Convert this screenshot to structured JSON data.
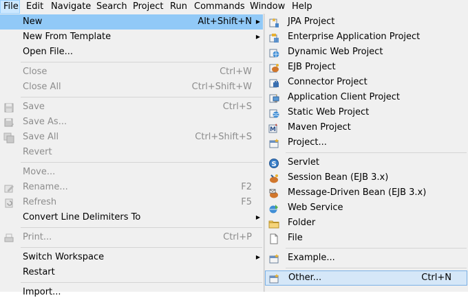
{
  "menubar": {
    "items": [
      "File",
      "Edit",
      "Navigate",
      "Search",
      "Project",
      "Run",
      "Commands",
      "Window",
      "Help"
    ]
  },
  "file_menu": {
    "items": [
      {
        "label": "New",
        "accel": "Alt+Shift+N",
        "submenu": true
      },
      {
        "label": "New From Template",
        "accel": "",
        "submenu": true
      },
      {
        "label": "Open File...",
        "accel": ""
      },
      {
        "label": "Close",
        "accel": "Ctrl+W"
      },
      {
        "label": "Close All",
        "accel": "Ctrl+Shift+W"
      },
      {
        "label": "Save",
        "accel": "Ctrl+S"
      },
      {
        "label": "Save As...",
        "accel": ""
      },
      {
        "label": "Save All",
        "accel": "Ctrl+Shift+S"
      },
      {
        "label": "Revert",
        "accel": ""
      },
      {
        "label": "Move...",
        "accel": ""
      },
      {
        "label": "Rename...",
        "accel": "F2"
      },
      {
        "label": "Refresh",
        "accel": "F5"
      },
      {
        "label": "Convert Line Delimiters To",
        "accel": "",
        "submenu": true
      },
      {
        "label": "Print...",
        "accel": "Ctrl+P"
      },
      {
        "label": "Switch Workspace",
        "accel": "",
        "submenu": true
      },
      {
        "label": "Restart",
        "accel": ""
      },
      {
        "label": "Import...",
        "accel": ""
      }
    ]
  },
  "new_submenu": {
    "items": [
      {
        "label": "JPA Project",
        "icon": "jpa-project-icon"
      },
      {
        "label": "Enterprise Application Project",
        "icon": "enterprise-project-icon"
      },
      {
        "label": "Dynamic Web Project",
        "icon": "web-project-icon"
      },
      {
        "label": "EJB Project",
        "icon": "ejb-project-icon"
      },
      {
        "label": "Connector Project",
        "icon": "connector-project-icon"
      },
      {
        "label": "Application Client Project",
        "icon": "app-client-project-icon"
      },
      {
        "label": "Static Web Project",
        "icon": "static-web-project-icon"
      },
      {
        "label": "Maven Project",
        "icon": "maven-project-icon"
      },
      {
        "label": "Project...",
        "icon": "project-wizard-icon"
      },
      {
        "label": "Servlet",
        "icon": "servlet-icon"
      },
      {
        "label": "Session Bean (EJB 3.x)",
        "icon": "session-bean-icon"
      },
      {
        "label": "Message-Driven Bean (EJB 3.x)",
        "icon": "mdb-icon"
      },
      {
        "label": "Web Service",
        "icon": "web-service-icon"
      },
      {
        "label": "Folder",
        "icon": "folder-icon"
      },
      {
        "label": "File",
        "icon": "file-icon"
      },
      {
        "label": "Example...",
        "icon": "example-wizard-icon"
      },
      {
        "label": "Other...",
        "accel": "Ctrl+N",
        "icon": "other-wizard-icon"
      }
    ]
  }
}
